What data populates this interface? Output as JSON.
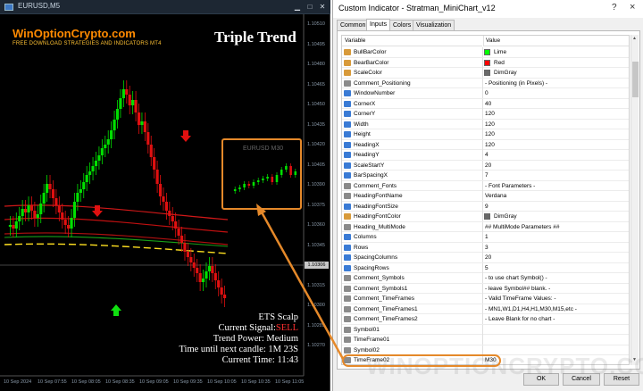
{
  "chart_window": {
    "title": "EURUSD,M5",
    "brand_title": "WinOptionCrypto.com",
    "brand_subtitle": "FREE DOWNLOAD STRATEGIES AND INDICATORS MT4",
    "indicator_title": "Triple Trend",
    "price_labels": [
      "1.10510",
      "1.10495",
      "1.10480",
      "1.10465",
      "1.10450",
      "1.10435",
      "1.10420",
      "1.10405",
      "1.10390",
      "1.10375",
      "1.10360",
      "1.10345",
      "1.10330",
      "1.10315",
      "1.10300",
      "1.10285",
      "1.10270"
    ],
    "current_price": "1.10306",
    "time_labels": [
      "10 Sep 2024",
      "10 Sep 07:55",
      "10 Sep 08:05",
      "10 Sep 08:35",
      "10 Sep 09:05",
      "10 Sep 09:35",
      "10 Sep 10:05",
      "10 Sep 10:35",
      "10 Sep 11:05"
    ],
    "minichart_title": "EURUSD M30",
    "info": {
      "title": "ETS Scalp",
      "signal_label": "Current Signal:",
      "signal_value": "SELL",
      "trend_power": "Trend Power: Medium",
      "next_candle": "Time until next candle: 1M 23S",
      "current_time": "Current Time: 11:43"
    },
    "colors": {
      "bull": "#00e000",
      "bear": "#e01010",
      "accent": "#e5892a"
    }
  },
  "dialog": {
    "title": "Custom Indicator - Stratman_MiniChart_v12",
    "help_icon": "?",
    "close_icon": "×",
    "tabs": [
      "Common",
      "Inputs",
      "Colors",
      "Visualization"
    ],
    "active_tab": "Inputs",
    "columns": {
      "variable": "Variable",
      "value": "Value"
    },
    "rows": [
      {
        "name": "BullBarColor",
        "value": "Lime",
        "swatch": "#00ff00",
        "kind": "clr"
      },
      {
        "name": "BearBarColor",
        "value": "Red",
        "swatch": "#ff0000",
        "kind": "clr"
      },
      {
        "name": "ScaleColor",
        "value": "DimGray",
        "swatch": "#696969",
        "kind": "clr"
      },
      {
        "name": "Comment_Positioning",
        "value": "- Positioning (in Pixels) -",
        "kind": "cmt"
      },
      {
        "name": "WindowNumber",
        "value": "0",
        "kind": "num"
      },
      {
        "name": "CornerX",
        "value": "40",
        "kind": "num"
      },
      {
        "name": "CornerY",
        "value": "120",
        "kind": "num"
      },
      {
        "name": "Width",
        "value": "120",
        "kind": "num"
      },
      {
        "name": "Height",
        "value": "120",
        "kind": "num"
      },
      {
        "name": "HeadingX",
        "value": "120",
        "kind": "num"
      },
      {
        "name": "HeadingY",
        "value": "4",
        "kind": "num"
      },
      {
        "name": "ScaleStartY",
        "value": "20",
        "kind": "num"
      },
      {
        "name": "BarSpacingX",
        "value": "7",
        "kind": "num"
      },
      {
        "name": "Comment_Fonts",
        "value": "- Font Parameters -",
        "kind": "cmt"
      },
      {
        "name": "HeadingFontName",
        "value": "Verdana",
        "kind": "cmt"
      },
      {
        "name": "HeadingFontSize",
        "value": "9",
        "kind": "num"
      },
      {
        "name": "HeadingFontColor",
        "value": "DimGray",
        "swatch": "#696969",
        "kind": "clr"
      },
      {
        "name": "Heading_MultiMode",
        "value": "## MultiMode Parameters ##",
        "kind": "cmt"
      },
      {
        "name": "Columns",
        "value": "1",
        "kind": "num"
      },
      {
        "name": "Rows",
        "value": "3",
        "kind": "num"
      },
      {
        "name": "SpacingColumns",
        "value": "20",
        "kind": "num"
      },
      {
        "name": "SpacingRows",
        "value": "5",
        "kind": "num"
      },
      {
        "name": "Comment_Symbols",
        "value": "- to use chart Symbol() -",
        "kind": "cmt"
      },
      {
        "name": "Comment_Symbols1",
        "value": "- leave Symbol## blank. -",
        "kind": "cmt"
      },
      {
        "name": "Comment_TimeFrames",
        "value": "- Valid TimeFrame Values: -",
        "kind": "cmt"
      },
      {
        "name": "Comment_TimeFrames1",
        "value": "- MN1,W1,D1,H4,H1,M30,M15,etc -",
        "kind": "cmt"
      },
      {
        "name": "Comment_TimeFrames2",
        "value": "- Leave Blank for no chart -",
        "kind": "cmt"
      },
      {
        "name": "Symbol01",
        "value": "",
        "kind": "cmt"
      },
      {
        "name": "TimeFrame01",
        "value": "",
        "kind": "cmt"
      },
      {
        "name": "Symbol02",
        "value": "",
        "kind": "cmt"
      },
      {
        "name": "TimeFrame02",
        "value": "M30",
        "kind": "cmt"
      }
    ],
    "buttons": {
      "ok": "OK",
      "cancel": "Cancel",
      "reset": "Reset"
    },
    "watermark": "WINOPTIONCRYPTO.COM"
  }
}
